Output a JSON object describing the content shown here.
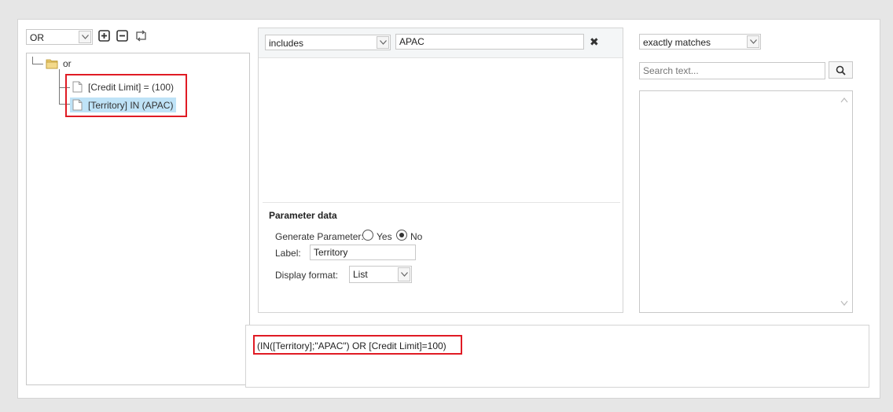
{
  "left": {
    "operator_select": "OR",
    "tree": {
      "root_label": "or",
      "children": [
        {
          "label": "[Credit Limit] = (100)"
        },
        {
          "label": "[Territory] IN (APAC)"
        }
      ]
    }
  },
  "middle": {
    "condition_select": "includes",
    "value_input": "APAC",
    "clear_symbol": "✖",
    "parameter": {
      "title": "Parameter data",
      "generate_label": "Generate Parameter:",
      "yes_label": "Yes",
      "no_label": "No",
      "generate_selected": "No",
      "label_label": "Label:",
      "label_value": "Territory",
      "display_format_label": "Display format:",
      "display_format_value": "List"
    }
  },
  "right": {
    "match_select": "exactly matches",
    "search_placeholder": "Search text..."
  },
  "expression": "(IN([Territory];\"APAC\") OR [Credit Limit]=100)",
  "colors": {
    "highlight_box": "#e01b24",
    "selected_node": "#bfe3f7"
  }
}
